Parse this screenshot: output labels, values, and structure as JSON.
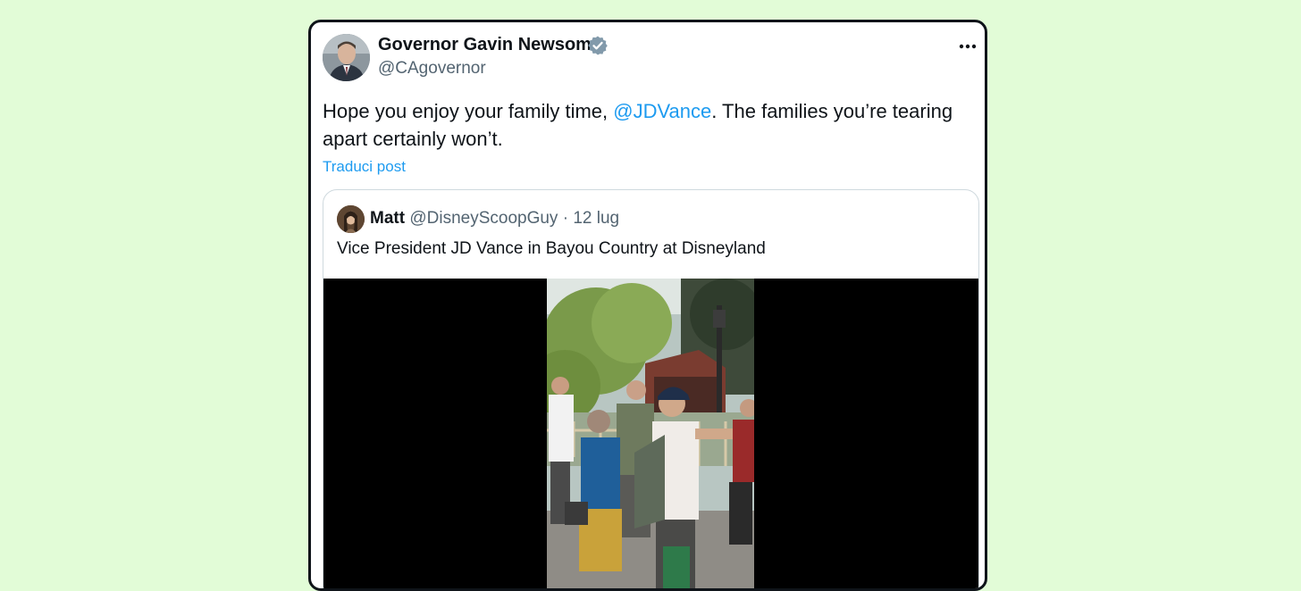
{
  "tweet": {
    "author_name": "Governor Gavin Newsom",
    "author_handle": "@CAgovernor",
    "text_before": "Hope you enjoy your family time, ",
    "mention": "@JDVance",
    "text_after": ". The families you’re tearing apart certainly won’t.",
    "translate_label": "Traduci post",
    "verified_icon": "verified-badge-icon",
    "more_icon": "more-options-icon"
  },
  "quoted": {
    "author_name": "Matt",
    "author_handle": "@DisneyScoopGuy",
    "separator": "·",
    "date": "12 lug",
    "text": "Vice President JD Vance in Bayou Country at Disneyland"
  },
  "colors": {
    "background": "#e2fcd7",
    "link": "#1d9bf0",
    "verified": "#829aab",
    "text": "#0f1419",
    "secondary": "#536471"
  }
}
